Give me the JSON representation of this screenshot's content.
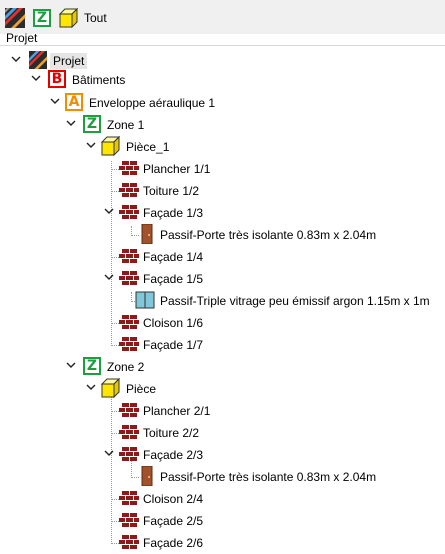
{
  "toolbar": {
    "all_label": "Tout",
    "icons": [
      "project-stripes-icon",
      "zone-z-icon",
      "room-cube-icon"
    ]
  },
  "section_label": "Projet",
  "colors": {
    "zone": "#1e9e3e",
    "building": "#e00000",
    "envelope": "#f28c00",
    "room": "#ffe600",
    "wall": "#8b1a1a",
    "door": "#a0522d",
    "window": "#7fc7d9"
  },
  "tree": {
    "project": "Projet",
    "buildings": "Bâtiments",
    "building_letter": "B",
    "envelope": "Enveloppe aéraulique 1",
    "envelope_letter": "A",
    "zone_letter": "Z",
    "zone1": {
      "label": "Zone 1",
      "room": "Pièce_1",
      "items": {
        "floor": "Plancher 1/1",
        "roof": "Toiture 1/2",
        "facade3": "Façade 1/3",
        "door": "Passif-Porte très isolante 0.83m x 2.04m",
        "facade4": "Façade 1/4",
        "facade5": "Façade 1/5",
        "window": "Passif-Triple vitrage peu émissif argon 1.15m x 1m",
        "partition": "Cloison 1/6",
        "facade7": "Façade 1/7"
      }
    },
    "zone2": {
      "label": "Zone 2",
      "room": "Pièce",
      "items": {
        "floor": "Plancher 2/1",
        "roof": "Toiture 2/2",
        "facade3": "Façade 2/3",
        "door": "Passif-Porte très isolante 0.83m x 2.04m",
        "partition": "Cloison 2/4",
        "facade5": "Façade 2/5",
        "facade6": "Façade 2/6"
      }
    }
  }
}
